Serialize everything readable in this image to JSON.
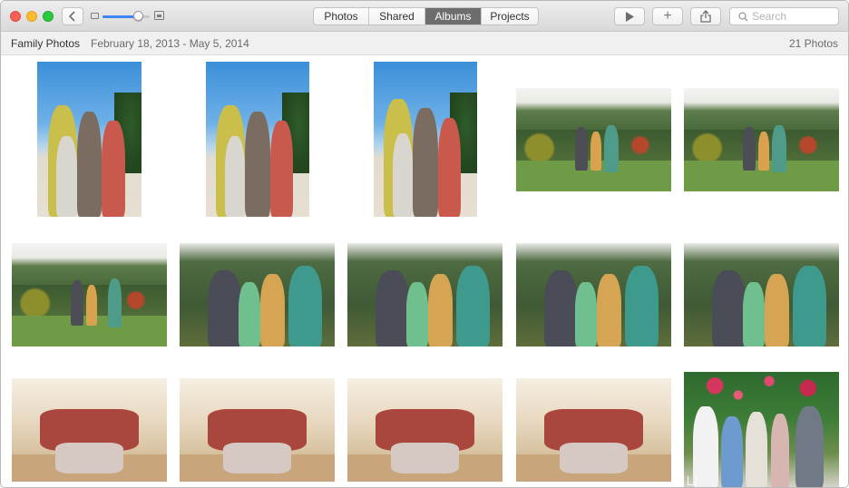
{
  "toolbar": {
    "tabs": [
      {
        "label": "Photos",
        "active": false
      },
      {
        "label": "Shared",
        "active": false
      },
      {
        "label": "Albums",
        "active": true
      },
      {
        "label": "Projects",
        "active": false
      }
    ],
    "add_label": "+",
    "search_placeholder": "Search",
    "zoom_level": 0.75,
    "icons": [
      "back-chevron-icon",
      "small-thumbnail-icon",
      "large-thumbnail-icon",
      "play-icon",
      "plus-icon",
      "share-icon",
      "search-icon"
    ]
  },
  "header": {
    "album_name": "Family Photos",
    "date_range": "February 18, 2013 - May 5, 2014",
    "photo_count": "21 Photos"
  },
  "colors": {
    "accent": "#3e86f4",
    "segment_active": "#6d6d6d",
    "close": "#fc5f57",
    "minimize": "#fdbc2e",
    "zoom": "#29c940"
  },
  "photos": [
    {
      "scene": "beach",
      "orientation": "portrait"
    },
    {
      "scene": "beach",
      "orientation": "portrait"
    },
    {
      "scene": "beach",
      "orientation": "portrait"
    },
    {
      "scene": "garden",
      "orientation": "landscape"
    },
    {
      "scene": "garden",
      "orientation": "landscape"
    },
    {
      "scene": "garden",
      "orientation": "landscape"
    },
    {
      "scene": "group",
      "orientation": "landscape"
    },
    {
      "scene": "group",
      "orientation": "landscape"
    },
    {
      "scene": "group",
      "orientation": "landscape"
    },
    {
      "scene": "group",
      "orientation": "landscape"
    },
    {
      "scene": "indoor",
      "orientation": "landscape"
    },
    {
      "scene": "indoor",
      "orientation": "landscape"
    },
    {
      "scene": "indoor",
      "orientation": "landscape"
    },
    {
      "scene": "indoor",
      "orientation": "landscape"
    },
    {
      "scene": "lei",
      "orientation": "portrait"
    }
  ]
}
